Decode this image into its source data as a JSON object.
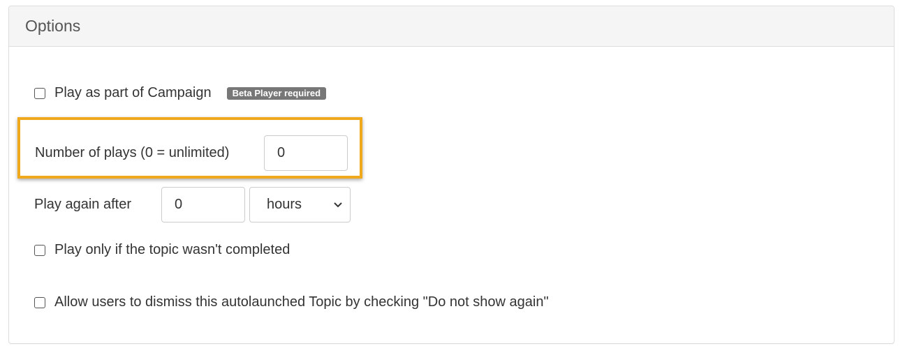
{
  "panel": {
    "title": "Options"
  },
  "options": {
    "campaign": {
      "label": "Play as part of Campaign",
      "checked": false,
      "badge": "Beta Player required"
    },
    "number_of_plays": {
      "label": "Number of plays (0 = unlimited)",
      "value": "0"
    },
    "play_again": {
      "label": "Play again after",
      "value": "0",
      "unit_selected": "hours"
    },
    "not_completed": {
      "label": "Play only if the topic wasn't completed",
      "checked": false
    },
    "dismiss": {
      "label": "Allow users to dismiss this autolaunched Topic by checking \"Do not show again\"",
      "checked": false
    }
  },
  "colors": {
    "highlight": "#f0a81c",
    "badge_bg": "#777777",
    "heading_bg": "#f5f5f5"
  }
}
